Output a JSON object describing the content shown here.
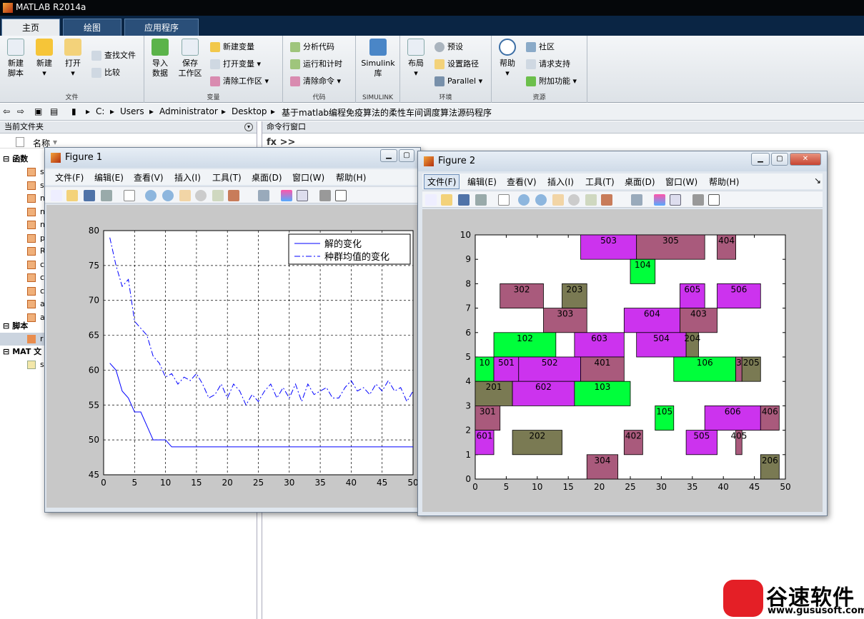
{
  "app": {
    "title": "MATLAB R2014a"
  },
  "tabs": [
    {
      "label": "主页"
    },
    {
      "label": "绘图"
    },
    {
      "label": "应用程序"
    }
  ],
  "ribbon": {
    "file": {
      "new_script": "新建\n脚本",
      "new": "新建",
      "open": "打开",
      "find_files": "查找文件",
      "compare": "比较",
      "group": "文件"
    },
    "variable": {
      "import": "导入\n数据",
      "save_ws": "保存\n工作区",
      "new_var": "新建变量",
      "open_var": "打开变量",
      "clear_ws": "清除工作区",
      "group": "变量"
    },
    "code": {
      "analyze": "分析代码",
      "run_time": "运行和计时",
      "clear_cmd": "清除命令",
      "group": "代码"
    },
    "simulink": {
      "lib": "Simulink\n库",
      "group": "SIMULINK"
    },
    "env": {
      "layout": "布局",
      "prefs": "预设",
      "set_path": "设置路径",
      "parallel": "Parallel",
      "group": "环境"
    },
    "resources": {
      "help": "帮助",
      "community": "社区",
      "support": "请求支持",
      "addons": "附加功能",
      "group": "资源"
    }
  },
  "address": {
    "crumbs": [
      "C:",
      "Users",
      "Administrator",
      "Desktop",
      "基于matlab编程免疫算法的柔性车间调度算法源码程序"
    ]
  },
  "left_panel": {
    "title": "当前文件夹",
    "col_name": "名称",
    "groups": [
      {
        "label": "函数"
      },
      {
        "label": "脚本"
      },
      {
        "label": "MAT 文"
      }
    ],
    "file_letters": [
      "s",
      "s",
      "n",
      "n",
      "n",
      "p",
      "R",
      "c",
      "c",
      "c",
      "a",
      "a"
    ],
    "script_letters": [
      "r"
    ],
    "mat_letters": [
      "s"
    ]
  },
  "cmd": {
    "title": "命令行窗口",
    "prompt": "fx >>"
  },
  "fig1": {
    "title": "Figure 1",
    "menus": [
      "文件(F)",
      "编辑(E)",
      "查看(V)",
      "插入(I)",
      "工具(T)",
      "桌面(D)",
      "窗口(W)",
      "帮助(H)"
    ]
  },
  "fig2": {
    "title": "Figure 2",
    "menus": [
      "文件(F)",
      "编辑(E)",
      "查看(V)",
      "插入(I)",
      "工具(T)",
      "桌面(D)",
      "窗口(W)",
      "帮助(H)"
    ]
  },
  "colors": {
    "green": "#00ff3b",
    "olive": "#7a7a53",
    "mauve": "#a95a7c",
    "magenta": "#cc33ee"
  },
  "logo": {
    "name": "谷速软件",
    "url": "www.gususoft.com"
  },
  "chart_data": [
    {
      "type": "line",
      "x": [
        1,
        2,
        3,
        4,
        5,
        6,
        7,
        8,
        9,
        10,
        11,
        12,
        13,
        14,
        15,
        16,
        17,
        18,
        19,
        20,
        21,
        22,
        23,
        24,
        25,
        26,
        27,
        28,
        29,
        30,
        31,
        32,
        33,
        34,
        35,
        36,
        37,
        38,
        39,
        40,
        41,
        42,
        43,
        44,
        45,
        46,
        47,
        48,
        49,
        50
      ],
      "series": [
        {
          "name": "解的变化",
          "style": "solid",
          "values": [
            61,
            60,
            57,
            56,
            54,
            54,
            52,
            50,
            50,
            50,
            49,
            49,
            49,
            49,
            49,
            49,
            49,
            49,
            49,
            49,
            49,
            49,
            49,
            49,
            49,
            49,
            49,
            49,
            49,
            49,
            49,
            49,
            49,
            49,
            49,
            49,
            49,
            49,
            49,
            49,
            49,
            49,
            49,
            49,
            49,
            49,
            49,
            49,
            49,
            49
          ]
        },
        {
          "name": "种群均值的变化",
          "style": "dashdot",
          "values": [
            79,
            75,
            72,
            73,
            67,
            66,
            65,
            62,
            61,
            59,
            59.5,
            58,
            59,
            58.5,
            59.5,
            58,
            56,
            56.5,
            58,
            56,
            58,
            57,
            55,
            56.5,
            55.5,
            57,
            58,
            56,
            57.5,
            56,
            58,
            55.5,
            58,
            56.5,
            57,
            57.5,
            56,
            56,
            57.5,
            58.5,
            57,
            57.5,
            56.5,
            58,
            57,
            58.5,
            57,
            57.5,
            55.5,
            57
          ]
        }
      ],
      "xlim": [
        0,
        50
      ],
      "ylim": [
        45,
        80
      ],
      "xticks": [
        0,
        5,
        10,
        15,
        20,
        25,
        30,
        35,
        40,
        45,
        50
      ],
      "yticks": [
        45,
        50,
        55,
        60,
        65,
        70,
        75,
        80
      ],
      "grid": true,
      "legend": "top-right"
    },
    {
      "type": "gantt",
      "xlim": [
        0,
        50
      ],
      "ylim": [
        0,
        10
      ],
      "xticks": [
        0,
        5,
        10,
        15,
        20,
        25,
        30,
        35,
        40,
        45,
        50
      ],
      "yticks": [
        0,
        1,
        2,
        3,
        4,
        5,
        6,
        7,
        8,
        9,
        10
      ],
      "bars": [
        {
          "label": "503",
          "x0": 17,
          "x1": 26,
          "y": 9,
          "color": "magenta"
        },
        {
          "label": "305",
          "x0": 26,
          "x1": 37,
          "y": 9,
          "color": "mauve"
        },
        {
          "label": "404",
          "x0": 39,
          "x1": 42,
          "y": 9,
          "color": "mauve"
        },
        {
          "label": "104",
          "x0": 25,
          "x1": 29,
          "y": 8,
          "color": "green"
        },
        {
          "label": "302",
          "x0": 4,
          "x1": 11,
          "y": 7,
          "color": "mauve"
        },
        {
          "label": "203",
          "x0": 14,
          "x1": 18,
          "y": 7,
          "color": "olive"
        },
        {
          "label": "605",
          "x0": 33,
          "x1": 37,
          "y": 7,
          "color": "magenta"
        },
        {
          "label": "506",
          "x0": 39,
          "x1": 46,
          "y": 7,
          "color": "magenta"
        },
        {
          "label": "303",
          "x0": 11,
          "x1": 18,
          "y": 6,
          "color": "mauve"
        },
        {
          "label": "604",
          "x0": 24,
          "x1": 33,
          "y": 6,
          "color": "magenta"
        },
        {
          "label": "403",
          "x0": 33,
          "x1": 39,
          "y": 6,
          "color": "mauve"
        },
        {
          "label": "102",
          "x0": 3,
          "x1": 13,
          "y": 5,
          "color": "green"
        },
        {
          "label": "603",
          "x0": 16,
          "x1": 24,
          "y": 5,
          "color": "magenta"
        },
        {
          "label": "504",
          "x0": 26,
          "x1": 34,
          "y": 5,
          "color": "magenta"
        },
        {
          "label": "204",
          "x0": 34,
          "x1": 36,
          "y": 5,
          "color": "olive"
        },
        {
          "label": "10",
          "x0": 0,
          "x1": 3,
          "y": 4,
          "color": "green"
        },
        {
          "label": "501",
          "x0": 3,
          "x1": 7,
          "y": 4,
          "color": "magenta"
        },
        {
          "label": "502",
          "x0": 7,
          "x1": 17,
          "y": 4,
          "color": "magenta"
        },
        {
          "label": "401",
          "x0": 17,
          "x1": 24,
          "y": 4,
          "color": "mauve"
        },
        {
          "label": "106",
          "x0": 32,
          "x1": 42,
          "y": 4,
          "color": "green"
        },
        {
          "label": "3",
          "x0": 42,
          "x1": 43,
          "y": 4,
          "color": "mauve"
        },
        {
          "label": "205",
          "x0": 43,
          "x1": 46,
          "y": 4,
          "color": "olive"
        },
        {
          "label": "201",
          "x0": 0,
          "x1": 6,
          "y": 3,
          "color": "olive"
        },
        {
          "label": "602",
          "x0": 6,
          "x1": 16,
          "y": 3,
          "color": "magenta"
        },
        {
          "label": "103",
          "x0": 16,
          "x1": 25,
          "y": 3,
          "color": "green"
        },
        {
          "label": "301",
          "x0": 0,
          "x1": 4,
          "y": 2,
          "color": "mauve"
        },
        {
          "label": "105",
          "x0": 29,
          "x1": 32,
          "y": 2,
          "color": "green"
        },
        {
          "label": "606",
          "x0": 37,
          "x1": 46,
          "y": 2,
          "color": "magenta"
        },
        {
          "label": "406",
          "x0": 46,
          "x1": 49,
          "y": 2,
          "color": "mauve"
        },
        {
          "label": "601",
          "x0": 0,
          "x1": 3,
          "y": 1,
          "color": "magenta"
        },
        {
          "label": "202",
          "x0": 6,
          "x1": 14,
          "y": 1,
          "color": "olive"
        },
        {
          "label": "402",
          "x0": 24,
          "x1": 27,
          "y": 1,
          "color": "mauve"
        },
        {
          "label": "505",
          "x0": 34,
          "x1": 39,
          "y": 1,
          "color": "magenta"
        },
        {
          "label": "405",
          "x0": 42,
          "x1": 43,
          "y": 1,
          "color": "mauve"
        },
        {
          "label": "304",
          "x0": 18,
          "x1": 23,
          "y": 0,
          "color": "mauve"
        },
        {
          "label": "206",
          "x0": 46,
          "x1": 49,
          "y": 0,
          "color": "olive"
        }
      ]
    }
  ]
}
